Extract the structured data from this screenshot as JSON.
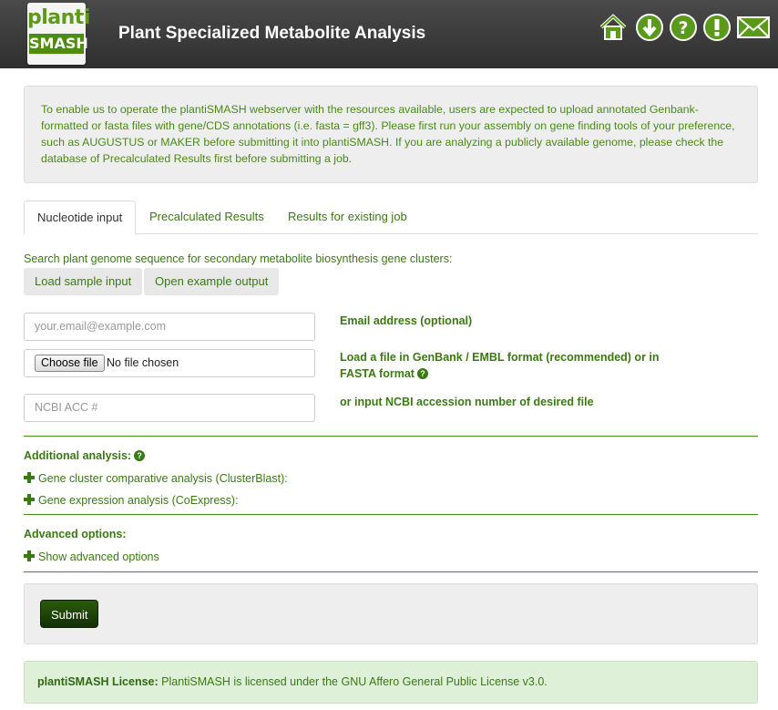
{
  "header": {
    "logo_top": "planti",
    "logo_bottom": "SMASH",
    "title": "Plant Specialized Metabolite Analysis",
    "icons": [
      "home-icon",
      "download-icon",
      "help-icon",
      "alert-icon",
      "mail-icon"
    ]
  },
  "info_text": "To enable us to operate the plantiSMASH webserver with the resources available, users are expected to upload annotated Genbank-formatted or fasta files with gene/CDS annotations (i.e. fasta = gff3). Please first run your assembly on gene finding tools of your preference, such as AUGUSTUS or MAKER before submitting it into plantiSMASH. If you are analyzing a publicly available genome, please check the database of Precalculated Results first before submitting a job.",
  "tabs": [
    {
      "label": "Nucleotide input"
    },
    {
      "label": "Precalculated Results"
    },
    {
      "label": "Results for existing job"
    }
  ],
  "search": {
    "description": "Search plant genome sequence for secondary metabolite biosynthesis gene clusters:",
    "load_sample": "Load sample input",
    "open_example": "Open example output"
  },
  "form": {
    "email_placeholder": "your.email@example.com",
    "email_label": "Email address (optional)",
    "file_button": "Choose file",
    "file_status": "No file chosen",
    "file_label_line1": "Load a file in GenBank / EMBL format (recommended) or in",
    "file_label_line2": "FASTA format",
    "ncbi_placeholder": "NCBI ACC #",
    "ncbi_label": "or input NCBI accession number of desired file"
  },
  "additional": {
    "title": "Additional analysis:",
    "items": [
      "Gene cluster comparative analysis (ClusterBlast):",
      "Gene expression analysis (CoExpress):"
    ]
  },
  "advanced": {
    "title": "Advanced options:",
    "toggle": "Show advanced options"
  },
  "submit_label": "Submit",
  "license": {
    "label": "plantiSMASH License:",
    "text": "PlantiSMASH is licensed under the GNU Affero General Public License v3.0."
  },
  "colors": {
    "header_bg": "#3a3a3a",
    "brand_green": "#3a7a12",
    "icon_green": "#4e8d10",
    "submit_bg": "#1e4409",
    "license_bg": "#dff0d8"
  }
}
